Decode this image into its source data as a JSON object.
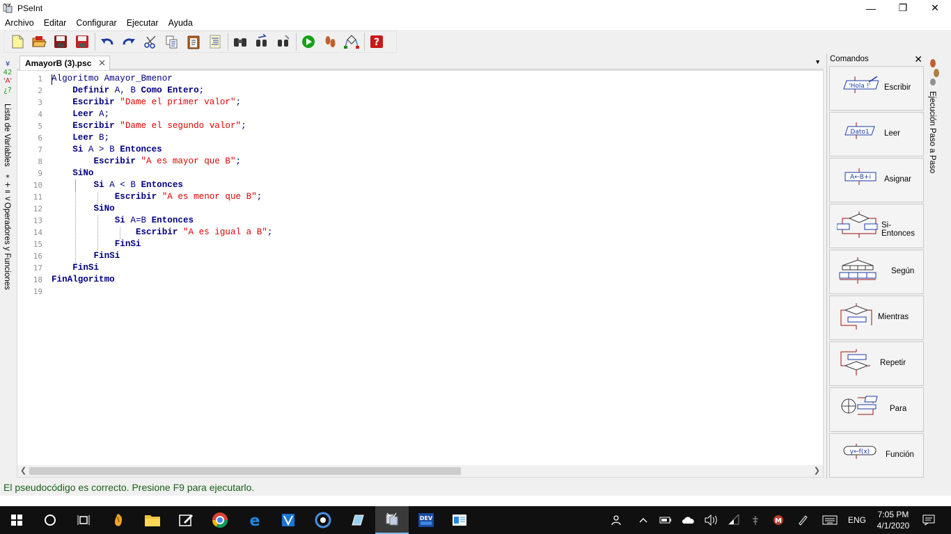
{
  "window": {
    "title": "PSeInt",
    "minimize": "—",
    "maximize": "❐",
    "close": "✕"
  },
  "menu": [
    "Archivo",
    "Editar",
    "Configurar",
    "Ejecutar",
    "Ayuda"
  ],
  "left_panel": {
    "variables_label": "Lista de Variables",
    "operators_label": "Operadores y Funciones"
  },
  "right_panel": {
    "step_label": "Ejecución Paso a Paso"
  },
  "tab": {
    "label": "AmayorB (3).psc",
    "close": "✕"
  },
  "line_numbers": [
    "1",
    "2",
    "3",
    "4",
    "5",
    "6",
    "7",
    "8",
    "9",
    "10",
    "11",
    "12",
    "13",
    "14",
    "15",
    "16",
    "17",
    "18",
    "19"
  ],
  "code": {
    "l1": {
      "kw": "Algoritmo",
      "rest": " Amayor_Bmenor"
    },
    "l2": {
      "a": "Definir",
      "b": " A, B ",
      "c": "Como Entero",
      "d": ";"
    },
    "l3": {
      "kw": "Escribir",
      "str": "\"Dame el primer valor\"",
      "end": ";"
    },
    "l4": {
      "kw": "Leer",
      "rest": " A;"
    },
    "l5": {
      "kw": "Escribir",
      "str": "\"Dame el segundo valor\"",
      "end": ";"
    },
    "l6": {
      "kw": "Leer",
      "rest": " B;"
    },
    "l7": {
      "a": "Si",
      "b": " A > B ",
      "c": "Entonces"
    },
    "l8": {
      "kw": "Escribir",
      "str": "\"A es mayor que B\"",
      "end": ";"
    },
    "l9": {
      "kw": "SiNo"
    },
    "l10": {
      "a": "Si",
      "b": " A < B ",
      "c": "Entonces"
    },
    "l11": {
      "kw": "Escribir",
      "str": "\"A es menor que B\"",
      "end": ";"
    },
    "l12": {
      "kw": "SiNo"
    },
    "l13": {
      "a": "Si",
      "b": " A=B ",
      "c": "Entonces"
    },
    "l14": {
      "kw": "Escribir",
      "str": "\"A es igual a B\"",
      "end": ";"
    },
    "l15": {
      "kw": "FinSi"
    },
    "l16": {
      "kw": "FinSi"
    },
    "l17": {
      "kw": "FinSi"
    },
    "l18": {
      "kw": "FinAlgoritmo"
    }
  },
  "commands": {
    "title": "Comandos",
    "close": "✕",
    "items": [
      {
        "label": "Escribir",
        "glyph": "'Hola !'"
      },
      {
        "label": "Leer",
        "glyph": "Dato1"
      },
      {
        "label": "Asignar",
        "glyph": "A←B+i"
      },
      {
        "label": "Si-Entonces"
      },
      {
        "label": "Según"
      },
      {
        "label": "Mientras"
      },
      {
        "label": "Repetir"
      },
      {
        "label": "Para"
      },
      {
        "label": "Función",
        "glyph": "y←f(x)"
      }
    ]
  },
  "status": "El pseudocódigo es correcto. Presione F9 para ejecutarlo.",
  "taskbar": {
    "lang": "ENG",
    "time": "7:05 PM",
    "date": "4/1/2020",
    "dev_label": "DEV"
  },
  "colors": {
    "keyword": "#000080",
    "string": "#e00000",
    "status_text": "#1a5e1a",
    "taskbar": "#101010"
  }
}
